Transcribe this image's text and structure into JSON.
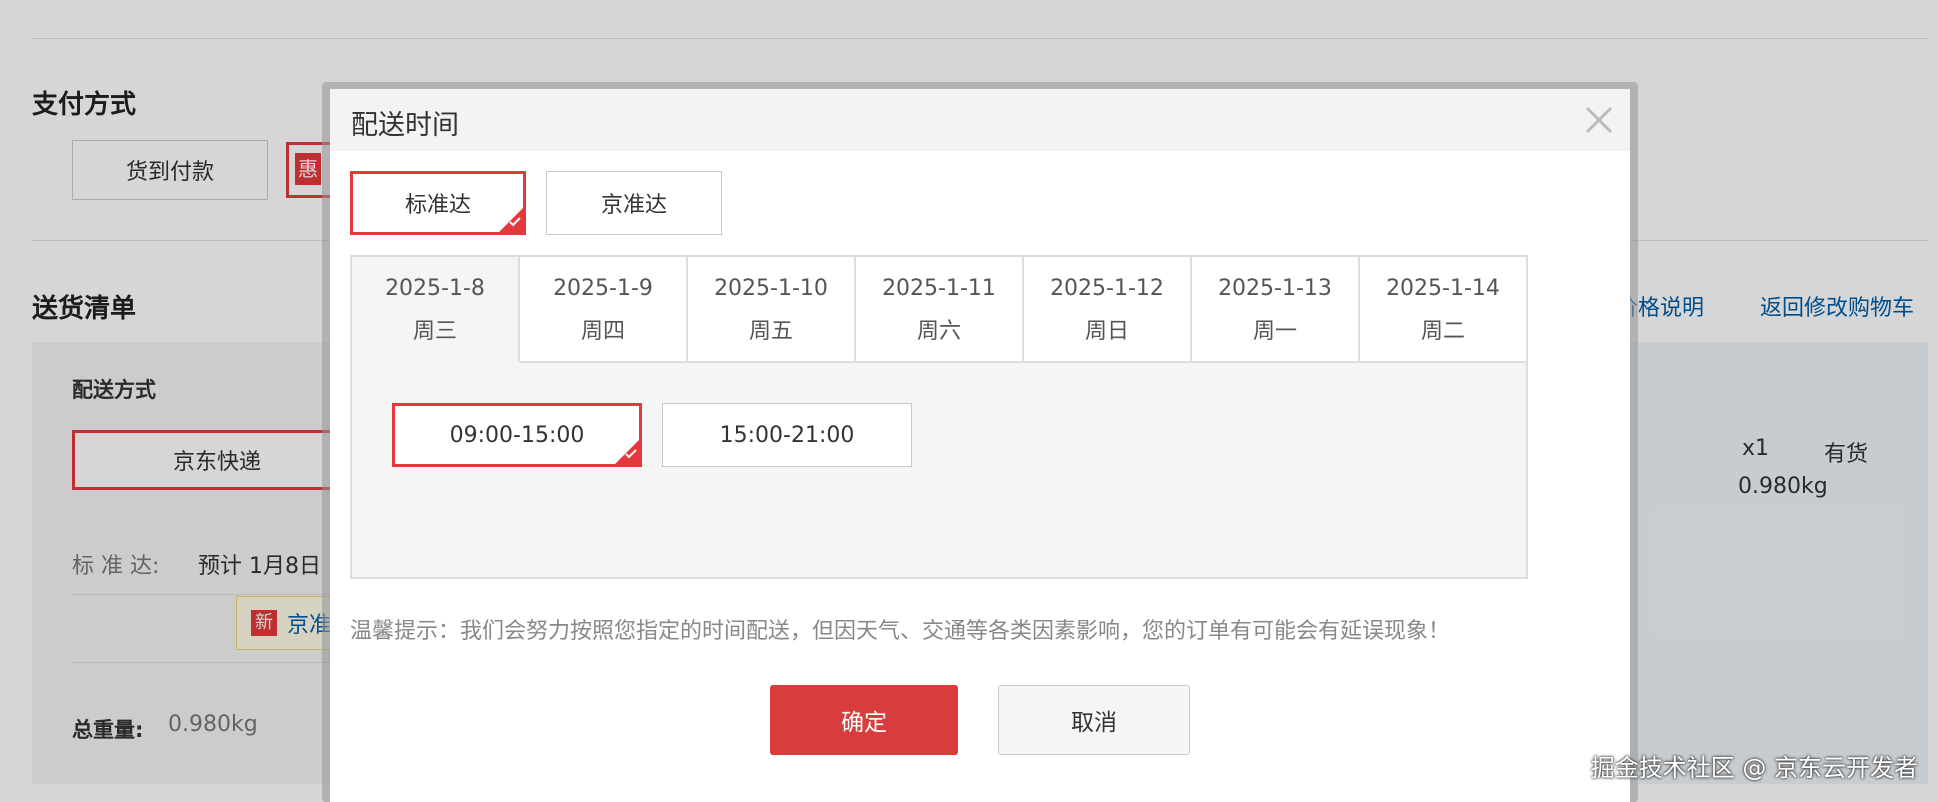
{
  "background": {
    "payment_title": "支付方式",
    "payment_cod": "货到付款",
    "payment_hui": "惠",
    "delivery_list_title": "送货清单",
    "link_price_note": "价格说明",
    "link_back_cart": "返回修改购物车",
    "shipping_method_label": "配送方式",
    "shipping_jd_express": "京东快递",
    "standard_label": "标 准 达:",
    "standard_eta": "预计 1月8日",
    "new_badge": "新",
    "new_text": "京准",
    "total_weight_label": "总重量:",
    "total_weight_value": "0.980kg",
    "item_qty": "x1",
    "item_stock": "有货",
    "item_weight": "0.980kg"
  },
  "modal": {
    "title": "配送时间",
    "delivery_types": [
      {
        "label": "标准达",
        "selected": true
      },
      {
        "label": "京准达",
        "selected": false
      }
    ],
    "dates": [
      {
        "date": "2025-1-8",
        "weekday": "周三",
        "selected": true
      },
      {
        "date": "2025-1-9",
        "weekday": "周四",
        "selected": false
      },
      {
        "date": "2025-1-10",
        "weekday": "周五",
        "selected": false
      },
      {
        "date": "2025-1-11",
        "weekday": "周六",
        "selected": false
      },
      {
        "date": "2025-1-12",
        "weekday": "周日",
        "selected": false
      },
      {
        "date": "2025-1-13",
        "weekday": "周一",
        "selected": false
      },
      {
        "date": "2025-1-14",
        "weekday": "周二",
        "selected": false
      }
    ],
    "time_slots": [
      {
        "label": "09:00-15:00",
        "selected": true
      },
      {
        "label": "15:00-21:00",
        "selected": false
      }
    ],
    "tip": "温馨提示：我们会努力按照您指定的时间配送，但因天气、交通等各类因素影响，您的订单有可能会有延误现象！",
    "confirm_label": "确定",
    "cancel_label": "取消"
  },
  "watermark": "掘金技术社区 @ 京东云开发者",
  "colors": {
    "accent_red": "#e4393c",
    "confirm_red": "#d83c3c",
    "link_blue": "#005ea7"
  }
}
